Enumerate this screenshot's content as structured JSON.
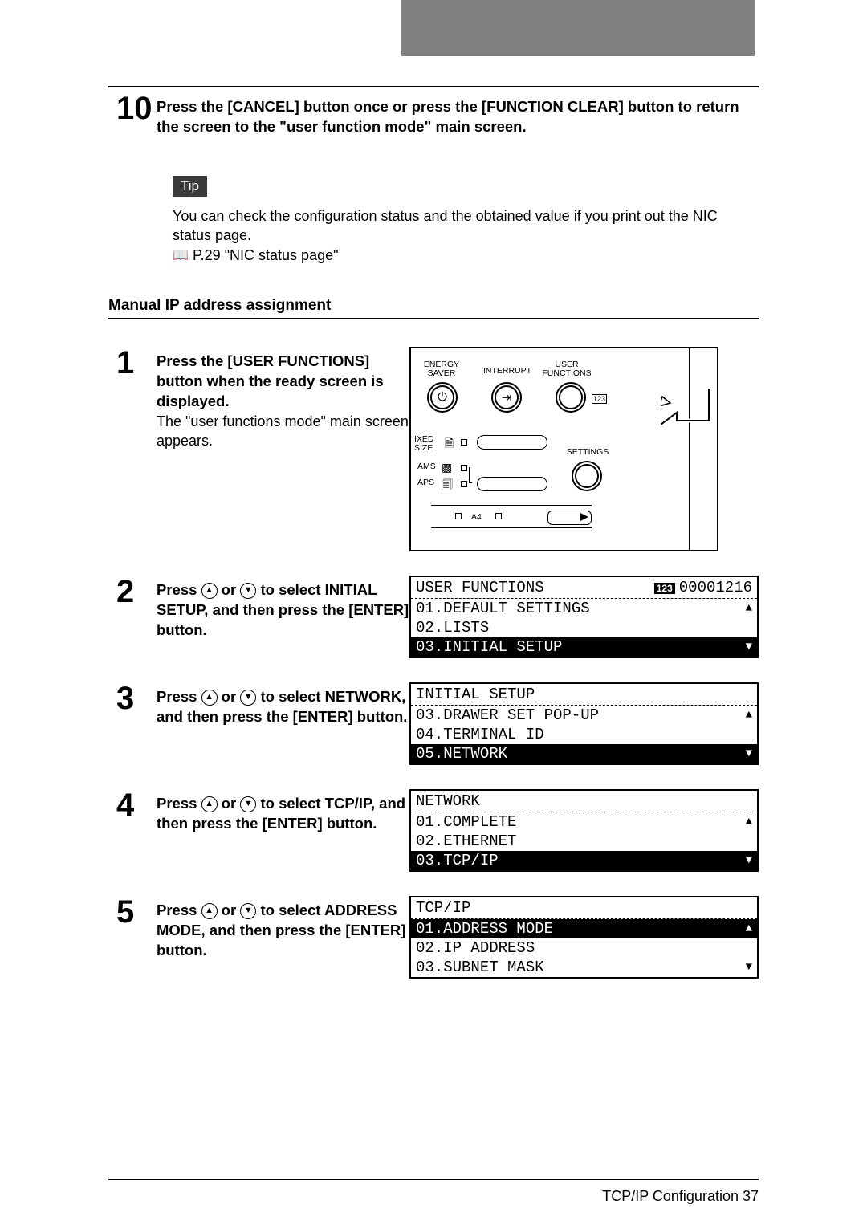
{
  "header": {},
  "step10": {
    "num": "10",
    "title": "Press the [CANCEL] button once or press the [FUNCTION CLEAR] button to return the screen to the \"user function mode\" main screen."
  },
  "tip": {
    "label": "Tip",
    "text": "You can check the configuration status and the obtained value if you print out the NIC status page.",
    "ref": "P.29 \"NIC status page\""
  },
  "section_title": "Manual IP address assignment",
  "panel": {
    "energy_saver": "ENERGY SAVER",
    "interrupt": "INTERRUPT",
    "user_functions": "USER FUNCTIONS",
    "mixed_size": "IXED SIZE",
    "ams": "AMS",
    "aps": "APS",
    "settings": "SETTINGS",
    "a4": "A4",
    "badge": "123"
  },
  "step1": {
    "num": "1",
    "title": "Press the [USER FUNCTIONS] button when the ready screen is displayed.",
    "text": "The \"user functions mode\" main screen appears."
  },
  "step2": {
    "num": "2",
    "title_a": "Press ",
    "title_b": " or ",
    "title_c": " to select INITIAL SETUP, and then press the [ENTER] button.",
    "lcd": {
      "head": "USER FUNCTIONS",
      "counter": "00001216",
      "badge": "123",
      "r1": "01.DEFAULT SETTINGS",
      "r2": "02.LISTS",
      "r3": "03.INITIAL SETUP"
    }
  },
  "step3": {
    "num": "3",
    "title_a": "Press ",
    "title_b": " or ",
    "title_c": " to select NETWORK, and then press the [ENTER] button.",
    "lcd": {
      "head": "INITIAL SETUP",
      "r1": "03.DRAWER SET POP-UP",
      "r2": "04.TERMINAL ID",
      "r3": "05.NETWORK"
    }
  },
  "step4": {
    "num": "4",
    "title_a": "Press ",
    "title_b": " or ",
    "title_c": " to select TCP/IP, and then press the [ENTER] button.",
    "lcd": {
      "head": "NETWORK",
      "r1": "01.COMPLETE",
      "r2": "02.ETHERNET",
      "r3": "03.TCP/IP"
    }
  },
  "step5": {
    "num": "5",
    "title_a": "Press ",
    "title_b": " or ",
    "title_c": " to select ADDRESS MODE, and then press the [ENTER] button.",
    "lcd": {
      "head": "TCP/IP",
      "r1": "01.ADDRESS MODE",
      "r2": "02.IP ADDRESS",
      "r3": "03.SUBNET MASK"
    }
  },
  "footer": {
    "text": "TCP/IP Configuration    37"
  }
}
